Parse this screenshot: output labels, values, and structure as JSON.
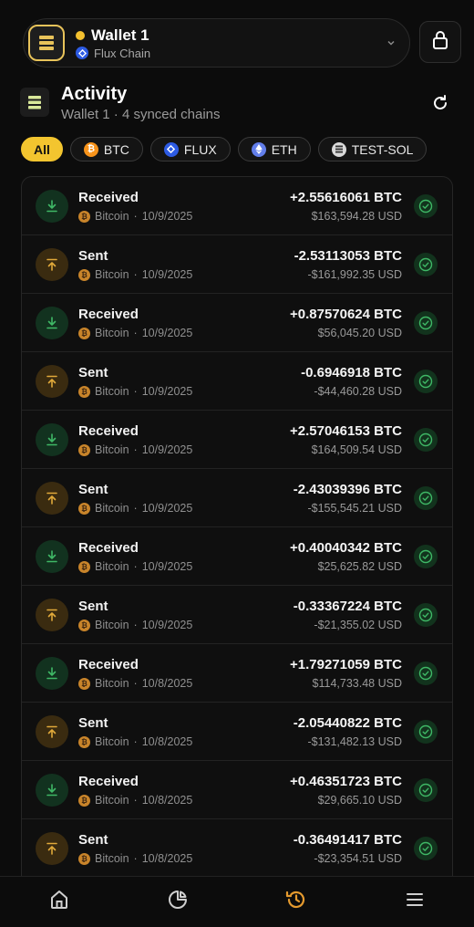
{
  "header": {
    "wallet_name": "Wallet 1",
    "chain_name": "Flux Chain",
    "status_color": "#f3c02f"
  },
  "activity": {
    "title": "Activity",
    "subtitle": "Wallet 1 · 4 synced chains"
  },
  "filters": [
    {
      "label": "All",
      "active": true
    },
    {
      "label": "BTC",
      "icon": "btc-icon",
      "color": "#f7931a"
    },
    {
      "label": "FLUX",
      "icon": "flux-icon",
      "color": "#2d5be3"
    },
    {
      "label": "ETH",
      "icon": "eth-icon",
      "color": "#627eea"
    },
    {
      "label": "TEST-SOL",
      "icon": "sol-icon",
      "color": "#d9d9d9"
    }
  ],
  "transactions": [
    {
      "type": "Received",
      "chain": "Bitcoin",
      "date": "10/9/2025",
      "amount": "+2.55616061 BTC",
      "usd": "$163,594.28 USD"
    },
    {
      "type": "Sent",
      "chain": "Bitcoin",
      "date": "10/9/2025",
      "amount": "-2.53113053 BTC",
      "usd": "-$161,992.35 USD"
    },
    {
      "type": "Received",
      "chain": "Bitcoin",
      "date": "10/9/2025",
      "amount": "+0.87570624 BTC",
      "usd": "$56,045.20 USD"
    },
    {
      "type": "Sent",
      "chain": "Bitcoin",
      "date": "10/9/2025",
      "amount": "-0.6946918 BTC",
      "usd": "-$44,460.28 USD"
    },
    {
      "type": "Received",
      "chain": "Bitcoin",
      "date": "10/9/2025",
      "amount": "+2.57046153 BTC",
      "usd": "$164,509.54 USD"
    },
    {
      "type": "Sent",
      "chain": "Bitcoin",
      "date": "10/9/2025",
      "amount": "-2.43039396 BTC",
      "usd": "-$155,545.21 USD"
    },
    {
      "type": "Received",
      "chain": "Bitcoin",
      "date": "10/9/2025",
      "amount": "+0.40040342 BTC",
      "usd": "$25,625.82 USD"
    },
    {
      "type": "Sent",
      "chain": "Bitcoin",
      "date": "10/9/2025",
      "amount": "-0.33367224 BTC",
      "usd": "-$21,355.02 USD"
    },
    {
      "type": "Received",
      "chain": "Bitcoin",
      "date": "10/8/2025",
      "amount": "+1.79271059 BTC",
      "usd": "$114,733.48 USD"
    },
    {
      "type": "Sent",
      "chain": "Bitcoin",
      "date": "10/8/2025",
      "amount": "-2.05440822 BTC",
      "usd": "-$131,482.13 USD"
    },
    {
      "type": "Received",
      "chain": "Bitcoin",
      "date": "10/8/2025",
      "amount": "+0.46351723 BTC",
      "usd": "$29,665.10 USD"
    },
    {
      "type": "Sent",
      "chain": "Bitcoin",
      "date": "10/8/2025",
      "amount": "-0.36491417 BTC",
      "usd": "-$23,354.51 USD"
    }
  ],
  "nav": [
    {
      "icon": "home-icon",
      "active": false
    },
    {
      "icon": "portfolio-chart-icon",
      "active": false
    },
    {
      "icon": "history-icon",
      "active": true
    },
    {
      "icon": "menu-icon",
      "active": false
    }
  ],
  "colors": {
    "accent": "#f3c52f",
    "received": "#3fb866",
    "sent": "#e0a93a",
    "nav_active": "#e59a2e"
  }
}
